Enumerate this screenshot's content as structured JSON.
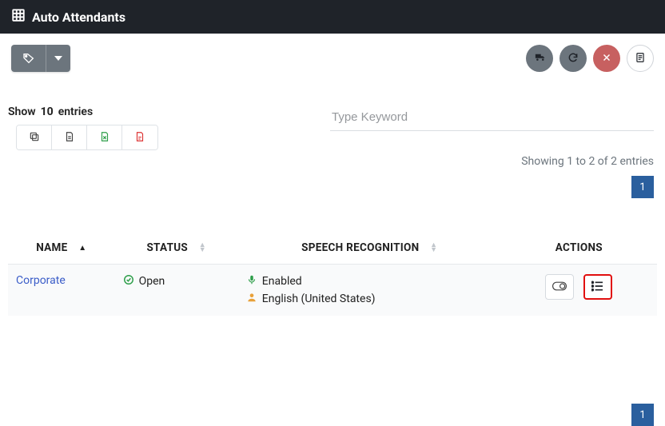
{
  "header": {
    "title": "Auto Attendants"
  },
  "search": {
    "placeholder": "Type Keyword"
  },
  "entries": {
    "show_label": "Show",
    "count": "10",
    "suffix": "entries"
  },
  "info": {
    "text": "Showing 1 to 2 of 2 entries"
  },
  "pager": {
    "current": "1"
  },
  "icons": {
    "grid": "grid-icon",
    "tag": "tag-icon",
    "caret": "caret-down-icon",
    "truck": "truck-icon",
    "refresh": "refresh-icon",
    "close": "close-x-icon",
    "notes": "notes-icon",
    "copy": "copy-icon",
    "doc": "document-icon",
    "xls": "spreadsheet-icon",
    "pdf": "pdf-icon",
    "check": "check-circle-icon",
    "mic": "microphone-icon",
    "person": "person-icon",
    "toggle": "toggle-icon",
    "list": "list-icon"
  },
  "columns": {
    "name": "NAME",
    "status": "STATUS",
    "sr": "SPEECH RECOGNITION",
    "actions": "ACTIONS"
  },
  "rows": [
    {
      "name": "Corporate",
      "status": "Open",
      "sr_enabled": "Enabled",
      "sr_language": "English (United States)"
    }
  ]
}
